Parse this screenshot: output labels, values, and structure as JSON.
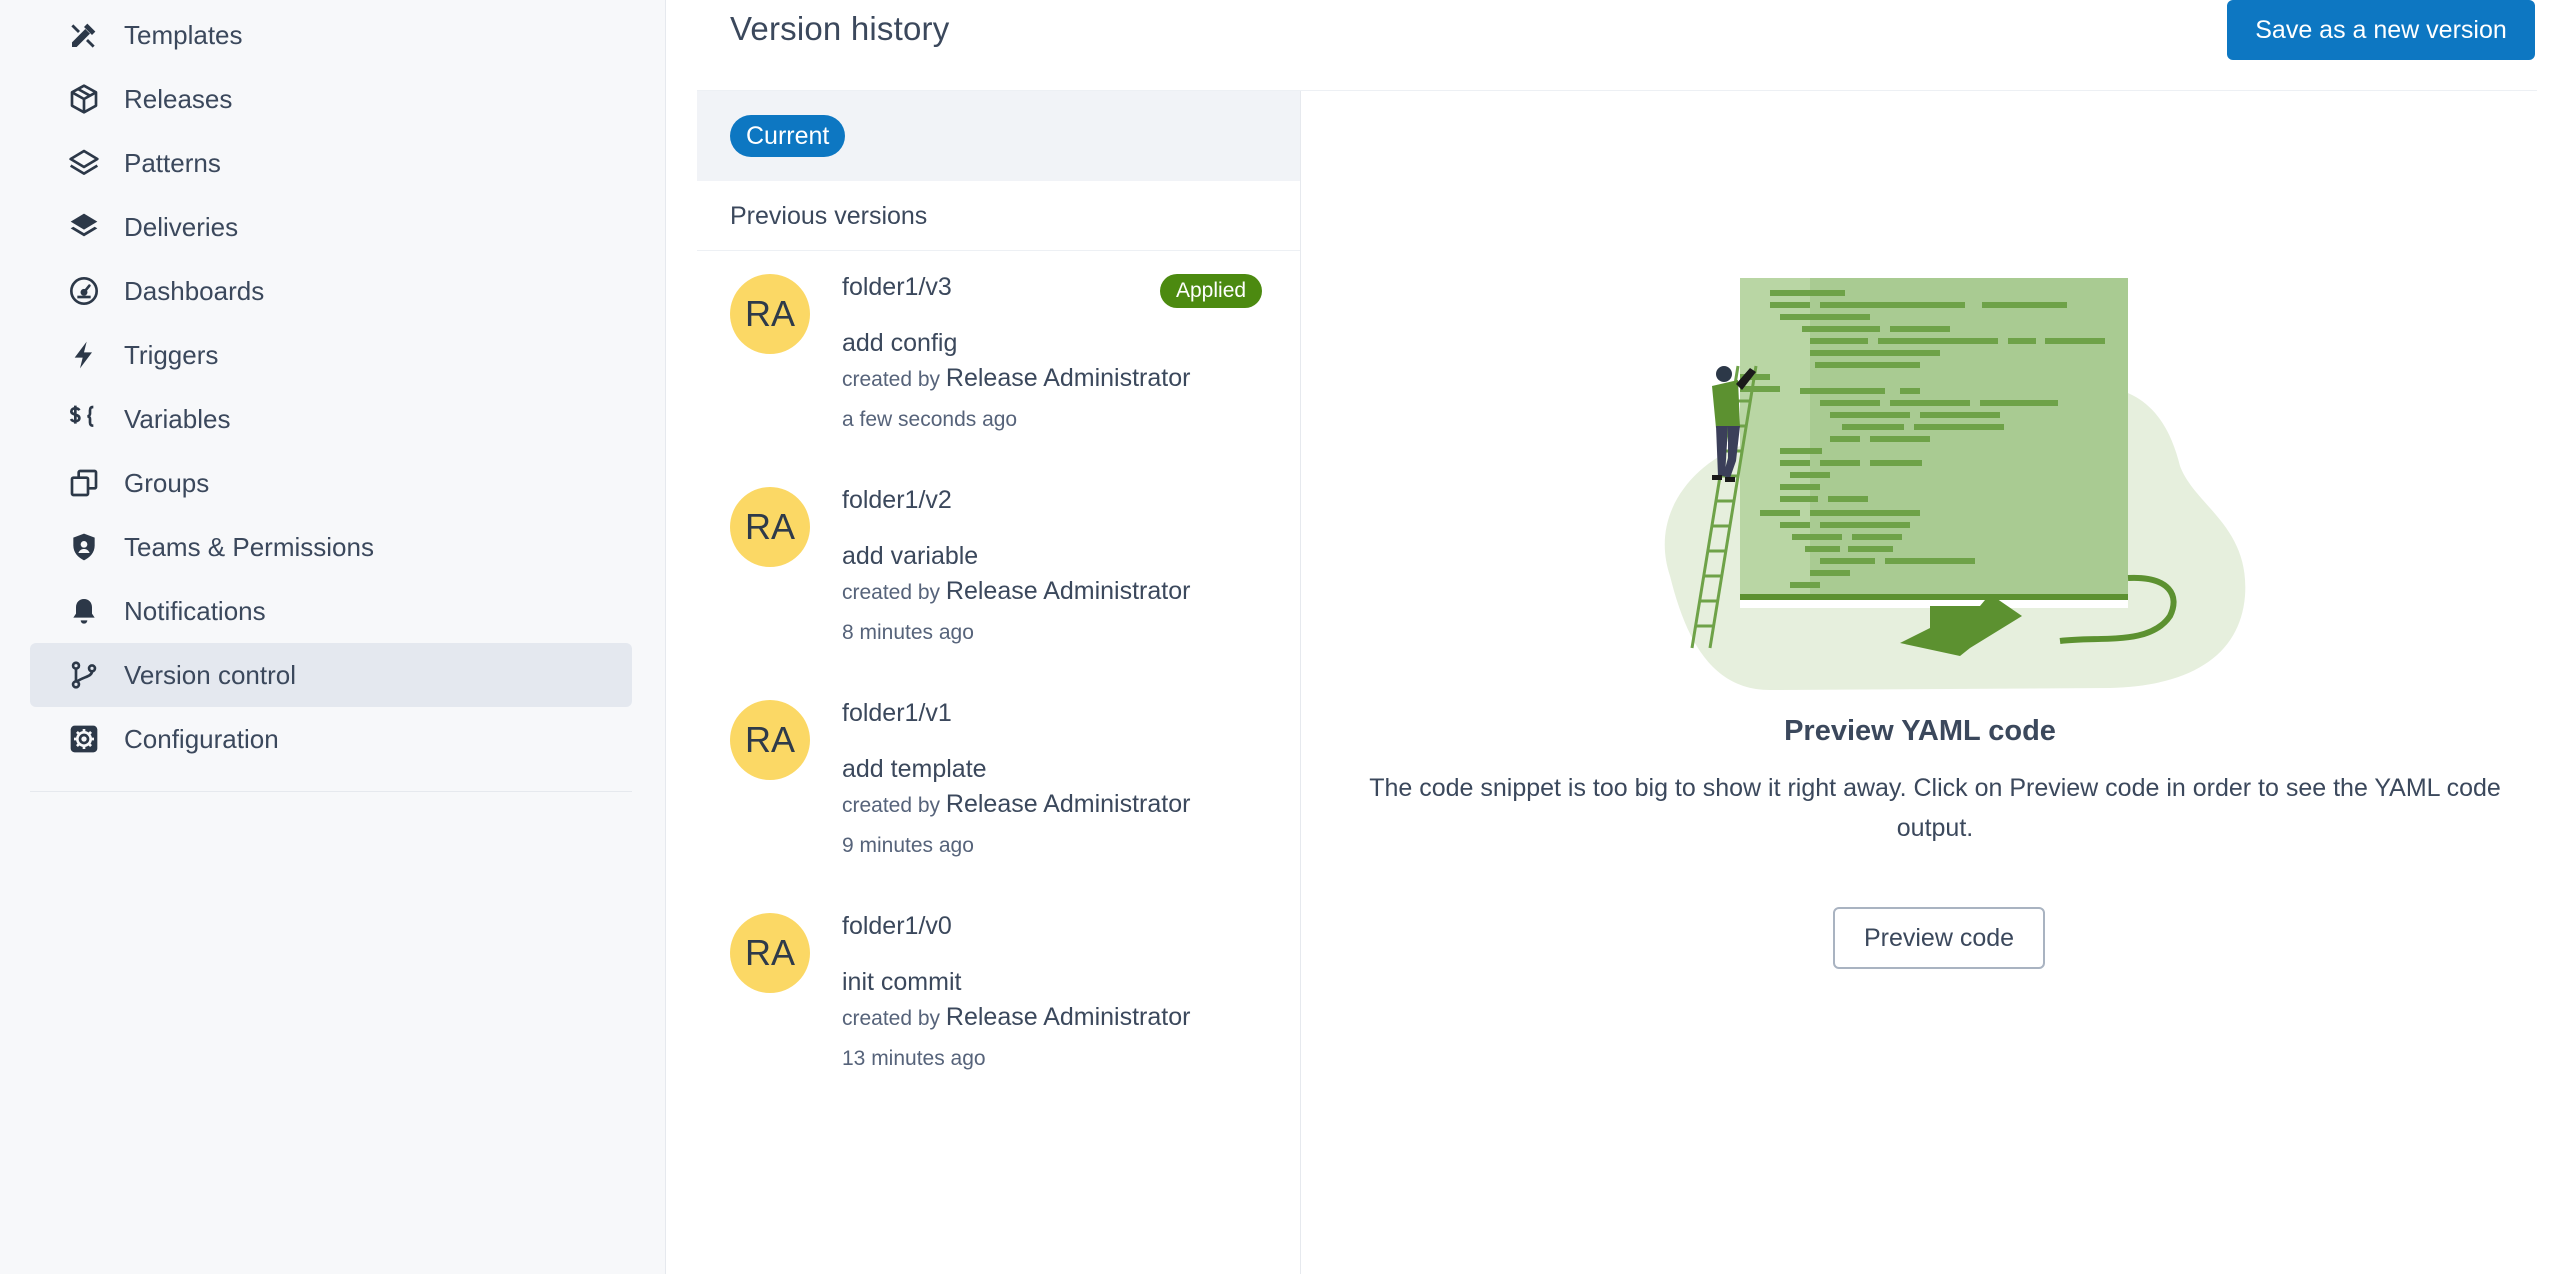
{
  "sidebar": {
    "items": [
      {
        "label": "Templates",
        "icon": "templates-icon"
      },
      {
        "label": "Releases",
        "icon": "releases-icon"
      },
      {
        "label": "Patterns",
        "icon": "patterns-icon"
      },
      {
        "label": "Deliveries",
        "icon": "deliveries-icon"
      },
      {
        "label": "Dashboards",
        "icon": "dashboards-icon"
      },
      {
        "label": "Triggers",
        "icon": "triggers-icon"
      },
      {
        "label": "Variables",
        "icon": "variables-icon"
      },
      {
        "label": "Groups",
        "icon": "groups-icon"
      },
      {
        "label": "Teams & Permissions",
        "icon": "shield-icon"
      },
      {
        "label": "Notifications",
        "icon": "bell-icon"
      },
      {
        "label": "Version control",
        "icon": "branch-icon",
        "active": true
      },
      {
        "label": "Configuration",
        "icon": "gear-icon"
      }
    ]
  },
  "header": {
    "title": "Version history",
    "save_label": "Save as a new version"
  },
  "versions": {
    "current_label": "Current",
    "previous_label": "Previous versions",
    "created_by_prefix": "created by",
    "items": [
      {
        "initials": "RA",
        "name": "folder1/v3",
        "message": "add config",
        "author": "Release Administrator",
        "time": "a few seconds ago",
        "badge": "Applied"
      },
      {
        "initials": "RA",
        "name": "folder1/v2",
        "message": "add variable",
        "author": "Release Administrator",
        "time": "8 minutes ago"
      },
      {
        "initials": "RA",
        "name": "folder1/v1",
        "message": "add template",
        "author": "Release Administrator",
        "time": "9 minutes ago"
      },
      {
        "initials": "RA",
        "name": "folder1/v0",
        "message": "init commit",
        "author": "Release Administrator",
        "time": "13 minutes ago"
      }
    ]
  },
  "preview": {
    "title": "Preview YAML code",
    "description": "The code snippet is too big to show it right away. Click on Preview code in order to see the YAML code output.",
    "button_label": "Preview code"
  },
  "colors": {
    "accent": "#0d77c2",
    "applied_badge": "#4c8a10",
    "avatar": "#fbd865",
    "sidebar_active": "#e4e8ef"
  }
}
